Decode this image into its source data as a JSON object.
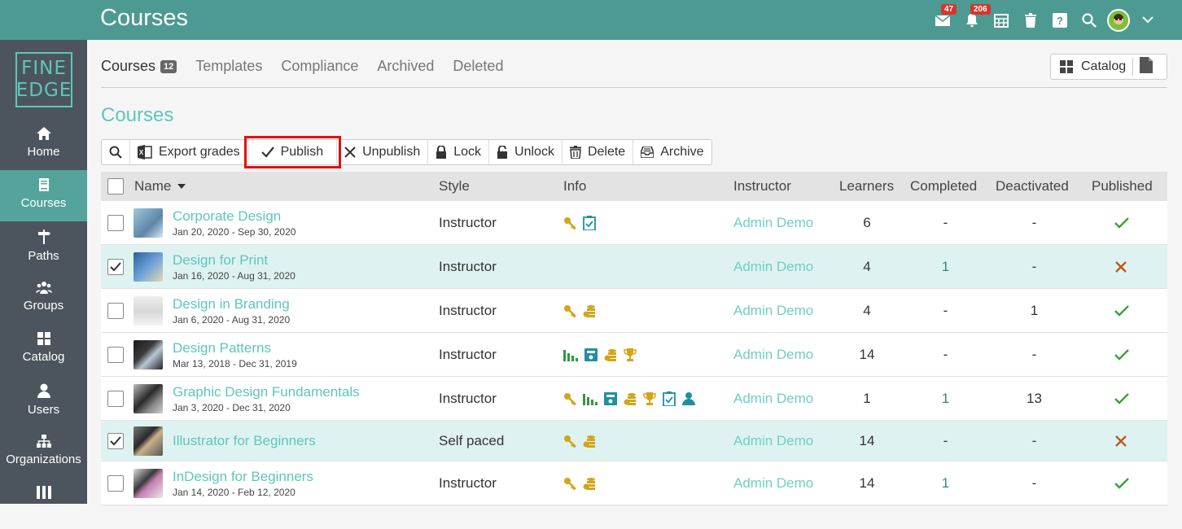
{
  "header": {
    "title": "Courses",
    "messages_count": "47",
    "notifications_count": "206"
  },
  "sidebar": {
    "logo_line1": "FINE",
    "logo_line2": "EDGE",
    "items": [
      {
        "label": "Home",
        "icon": "home-icon"
      },
      {
        "label": "Courses",
        "icon": "book-icon"
      },
      {
        "label": "Paths",
        "icon": "signpost-icon"
      },
      {
        "label": "Groups",
        "icon": "users-icon"
      },
      {
        "label": "Catalog",
        "icon": "grid-icon"
      },
      {
        "label": "Users",
        "icon": "user-icon"
      },
      {
        "label": "Organizations",
        "icon": "sitemap-icon"
      }
    ]
  },
  "tabs": [
    {
      "label": "Courses",
      "count": "12"
    },
    {
      "label": "Templates"
    },
    {
      "label": "Compliance"
    },
    {
      "label": "Archived"
    },
    {
      "label": "Deleted"
    }
  ],
  "catalog_button": "Catalog",
  "section_title": "Courses",
  "toolbar": {
    "export": "Export grades",
    "publish": "Publish",
    "unpublish": "Unpublish",
    "lock": "Lock",
    "unlock": "Unlock",
    "delete": "Delete",
    "archive": "Archive"
  },
  "columns": {
    "name": "Name",
    "style": "Style",
    "info": "Info",
    "instructor": "Instructor",
    "learners": "Learners",
    "completed": "Completed",
    "deactivated": "Deactivated",
    "published": "Published"
  },
  "rows": [
    {
      "name": "Corporate Design",
      "dates": "Jan 20, 2020 - Sep 30, 2020",
      "style": "Instructor",
      "instructor": "Admin Demo",
      "learners": "6",
      "completed": "-",
      "deactivated": "-",
      "published": true,
      "selected": false
    },
    {
      "name": "Design for Print",
      "dates": "Jan 16, 2020 - Aug 31, 2020",
      "style": "Instructor",
      "instructor": "Admin Demo",
      "learners": "4",
      "completed": "1",
      "deactivated": "-",
      "published": false,
      "selected": true
    },
    {
      "name": "Design in Branding",
      "dates": "Jan 6, 2020 - Aug 31, 2020",
      "style": "Instructor",
      "instructor": "Admin Demo",
      "learners": "4",
      "completed": "-",
      "deactivated": "1",
      "published": true,
      "selected": false
    },
    {
      "name": "Design Patterns",
      "dates": "Mar 13, 2018 - Dec 31, 2019",
      "style": "Instructor",
      "instructor": "Admin Demo",
      "learners": "14",
      "completed": "-",
      "deactivated": "-",
      "published": true,
      "selected": false
    },
    {
      "name": "Graphic Design Fundamentals",
      "dates": "Jan 3, 2020 - Dec 31, 2020",
      "style": "Instructor",
      "instructor": "Admin Demo",
      "learners": "1",
      "completed": "1",
      "deactivated": "13",
      "published": true,
      "selected": false
    },
    {
      "name": "Illustrator for Beginners",
      "dates": "",
      "style": "Self paced",
      "instructor": "Admin Demo",
      "learners": "14",
      "completed": "-",
      "deactivated": "-",
      "published": false,
      "selected": true
    },
    {
      "name": "InDesign for Beginners",
      "dates": "Jan 14, 2020 - Feb 12, 2020",
      "style": "Instructor",
      "instructor": "Admin Demo",
      "learners": "14",
      "completed": "1",
      "deactivated": "-",
      "published": true,
      "selected": false
    }
  ],
  "colors": {
    "brand": "#4d9a92",
    "accent": "#5ec6bc",
    "sidebar": "#4c555d",
    "check": "#3aa13a",
    "cross": "#c1561f",
    "gold": "#d4a41a"
  }
}
